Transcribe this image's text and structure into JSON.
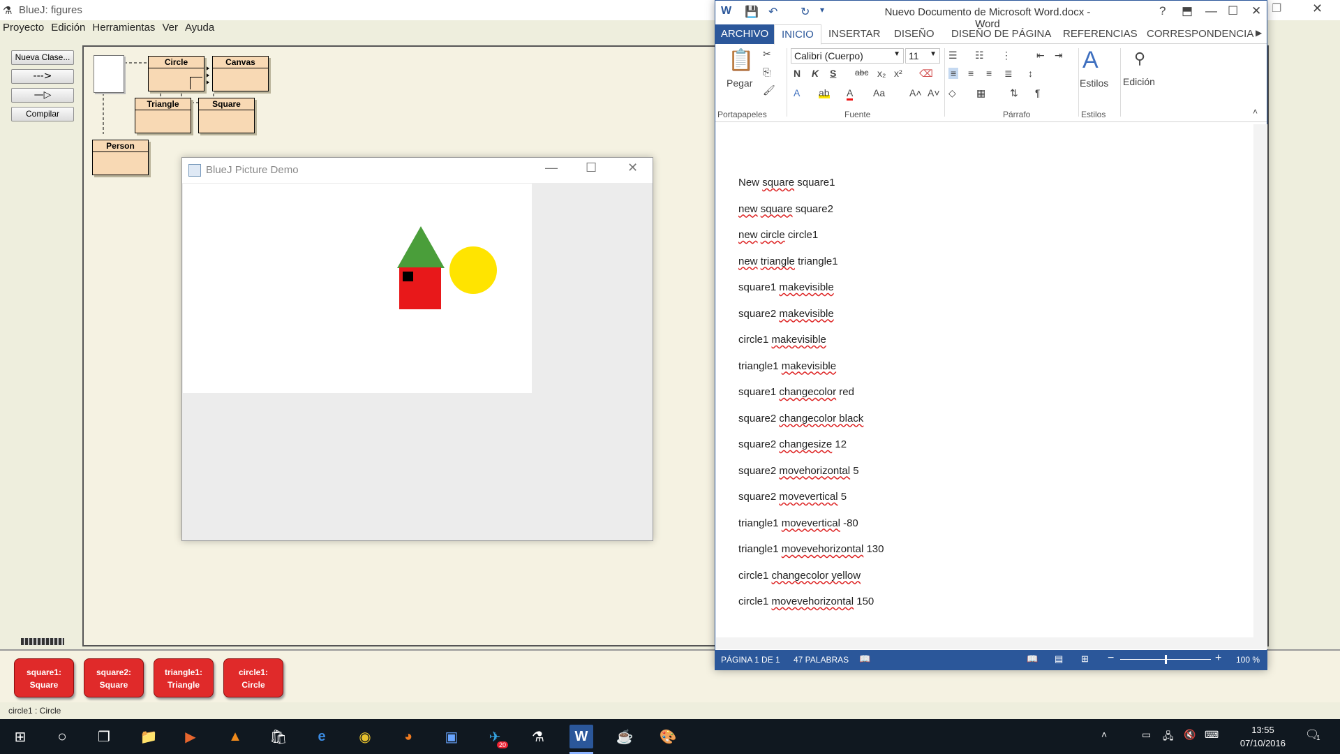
{
  "bluej": {
    "title": "BlueJ:  figures",
    "menu": [
      "Proyecto",
      "Edición",
      "Herramientas",
      "Ver",
      "Ayuda"
    ],
    "side_buttons": {
      "new_class": "Nueva Clase...",
      "dep_arrow": "--->",
      "inherit_arrow": "—▷",
      "compile": "Compilar"
    },
    "classes": {
      "circle": "Circle",
      "canvas": "Canvas",
      "triangle": "Triangle",
      "square": "Square",
      "person": "Person"
    },
    "objects": [
      {
        "line1": "square1:",
        "line2": "Square"
      },
      {
        "line1": "square2:",
        "line2": "Square"
      },
      {
        "line1": "triangle1:",
        "line2": "Triangle"
      },
      {
        "line1": "circle1:",
        "line2": "Circle"
      }
    ],
    "status": "circle1 : Circle"
  },
  "picture": {
    "title": "BlueJ Picture Demo",
    "colors": {
      "roof": "#4a9e3a",
      "wall": "#e8181a",
      "window": "#000000",
      "sun": "#ffe400"
    }
  },
  "word": {
    "title": "Nuevo Documento de Microsoft Word.docx - Word",
    "tabs": [
      "ARCHIVO",
      "INICIO",
      "INSERTAR",
      "DISEÑO",
      "DISEÑO DE PÁGINA",
      "REFERENCIAS",
      "CORRESPONDENCIA"
    ],
    "ribbon": {
      "paste": "Pegar",
      "font_name": "Calibri (Cuerpo)",
      "font_size": "11",
      "bold": "N",
      "italic": "K",
      "underline": "S",
      "styles": "Estilos",
      "editing": "Edición",
      "groups": [
        "Portapapeles",
        "Fuente",
        "Párrafo",
        "Estilos"
      ]
    },
    "lines": [
      [
        {
          "t": "New "
        },
        {
          "t": "square",
          "s": true
        },
        {
          "t": " square1"
        }
      ],
      [
        {
          "t": "new",
          "s": true
        },
        {
          "t": " "
        },
        {
          "t": "square",
          "s": true
        },
        {
          "t": " square2"
        }
      ],
      [
        {
          "t": "new",
          "s": true
        },
        {
          "t": " "
        },
        {
          "t": "circle",
          "s": true
        },
        {
          "t": " circle1"
        }
      ],
      [
        {
          "t": "new",
          "s": true
        },
        {
          "t": " "
        },
        {
          "t": "triangle",
          "s": true
        },
        {
          "t": " triangle1"
        }
      ],
      [
        {
          "t": "square1 "
        },
        {
          "t": "makevisible",
          "s": true
        }
      ],
      [
        {
          "t": "square2 "
        },
        {
          "t": "makevisible",
          "s": true
        }
      ],
      [
        {
          "t": "circle1 "
        },
        {
          "t": "makevisible",
          "s": true
        }
      ],
      [
        {
          "t": "triangle1 "
        },
        {
          "t": "makevisible",
          "s": true
        }
      ],
      [
        {
          "t": "square1 "
        },
        {
          "t": "changecolor",
          "s": true
        },
        {
          "t": " red"
        }
      ],
      [
        {
          "t": "square2 "
        },
        {
          "t": "changecolor black",
          "s": true
        }
      ],
      [
        {
          "t": "square2 "
        },
        {
          "t": "changesize",
          "s": true
        },
        {
          "t": " 12"
        }
      ],
      [
        {
          "t": "square2 "
        },
        {
          "t": "movehorizontal",
          "s": true
        },
        {
          "t": " 5"
        }
      ],
      [
        {
          "t": "square2 "
        },
        {
          "t": "movevertical",
          "s": true
        },
        {
          "t": " 5"
        }
      ],
      [
        {
          "t": "triangle1 "
        },
        {
          "t": "movevertical",
          "s": true
        },
        {
          "t": " -80"
        }
      ],
      [
        {
          "t": "triangle1 "
        },
        {
          "t": "movevehorizontal",
          "s": true
        },
        {
          "t": " 130"
        }
      ],
      [
        {
          "t": "circle1 "
        },
        {
          "t": "changecolor yellow",
          "s": true
        }
      ],
      [
        {
          "t": "circle1 "
        },
        {
          "t": "movevehorizontal",
          "s": true
        },
        {
          "t": " 150"
        }
      ]
    ],
    "status": {
      "page": "PÁGINA 1 DE 1",
      "words": "47 PALABRAS",
      "zoom": "100 %"
    },
    "zoom_fraction": 0.5
  },
  "taskbar": {
    "time": "13:55",
    "date": "07/10/2016",
    "telegram_badge": "20",
    "notification_count": "1"
  }
}
